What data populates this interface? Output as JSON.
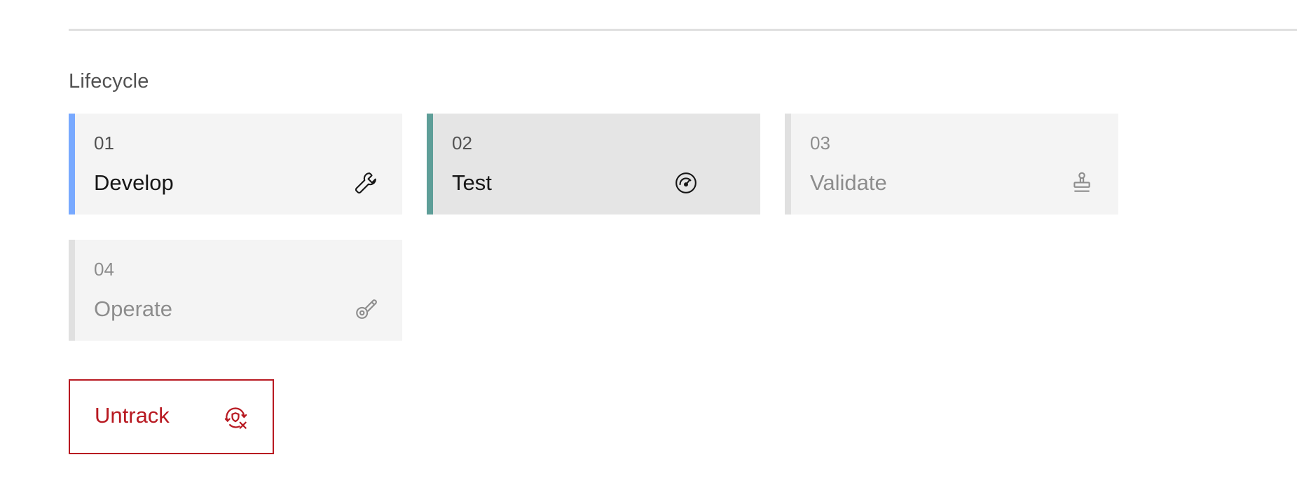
{
  "lifecycle": {
    "heading": "Lifecycle",
    "stages": [
      {
        "number": "01",
        "label": "Develop",
        "icon": "wrench-icon",
        "status": "active",
        "accent": "#78a9ff"
      },
      {
        "number": "02",
        "label": "Test",
        "icon": "gauge-icon",
        "status": "current",
        "accent": "#5e9e98"
      },
      {
        "number": "03",
        "label": "Validate",
        "icon": "stamp-icon",
        "status": "pending",
        "accent": "#e0e0e0"
      },
      {
        "number": "04",
        "label": "Operate",
        "icon": "deploy-icon",
        "status": "pending",
        "accent": "#e0e0e0"
      }
    ]
  },
  "actions": {
    "untrack": {
      "label": "Untrack",
      "icon": "untrack-icon",
      "color": "#b81921"
    }
  }
}
